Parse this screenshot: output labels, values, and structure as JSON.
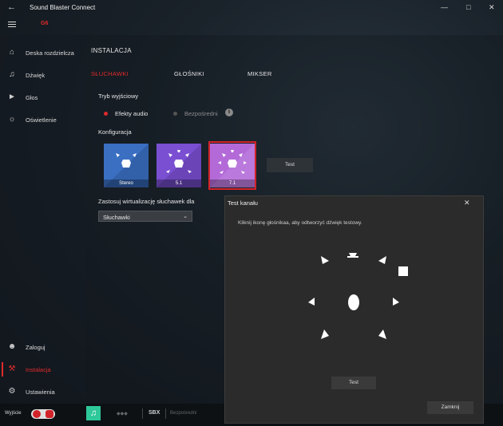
{
  "window": {
    "title": "Sound Blaster Connect",
    "device": "G6"
  },
  "sidebar": {
    "items": [
      {
        "label": "Deska rozdzielcza",
        "icon": "home-icon"
      },
      {
        "label": "Dźwięk",
        "icon": "music-note-icon"
      },
      {
        "label": "Głos",
        "icon": "voice-icon"
      },
      {
        "label": "Oświetlenie",
        "icon": "lightbulb-icon"
      }
    ],
    "bottom_items": [
      {
        "label": "Zaloguj",
        "icon": "user-icon"
      },
      {
        "label": "Instalacja",
        "icon": "wrench-icon"
      },
      {
        "label": "Ustawienia",
        "icon": "gear-icon"
      }
    ]
  },
  "main": {
    "section_title": "INSTALACJA",
    "tabs": [
      {
        "label": "SŁUCHAWKI",
        "active": true
      },
      {
        "label": "GŁOŚNIKI",
        "active": false
      },
      {
        "label": "MIKSER",
        "active": false
      }
    ],
    "output_mode_label": "Tryb wyjściowy",
    "output_modes": [
      {
        "label": "Efekty audio",
        "selected": true
      },
      {
        "label": "Bezpośredni",
        "selected": false
      }
    ],
    "config_label": "Konfiguracja",
    "configs": [
      {
        "label": "Stereo",
        "color": "#3a6fc2"
      },
      {
        "label": "5.1",
        "color": "#7a4fd2"
      },
      {
        "label": "7.1",
        "color": "#b36ad8",
        "selected": true
      }
    ],
    "test_button": "Test",
    "virtualization_label": "Zastosuj wirtualizację słuchawek dla",
    "virtualization_value": "Słuchawki"
  },
  "dialog": {
    "title": "Test kanału",
    "hint": "Kliknij ikonę głośnikaa, aby odtworzyć dźwięk testowy.",
    "test_button": "Test",
    "close_button": "Zamknij"
  },
  "bottombar": {
    "exit_label": "Wyjście",
    "brands": [
      "SBX",
      "Bezpośredni"
    ]
  },
  "colors": {
    "accent": "#e02b2b",
    "dialog_bg": "#2b2b2b"
  }
}
